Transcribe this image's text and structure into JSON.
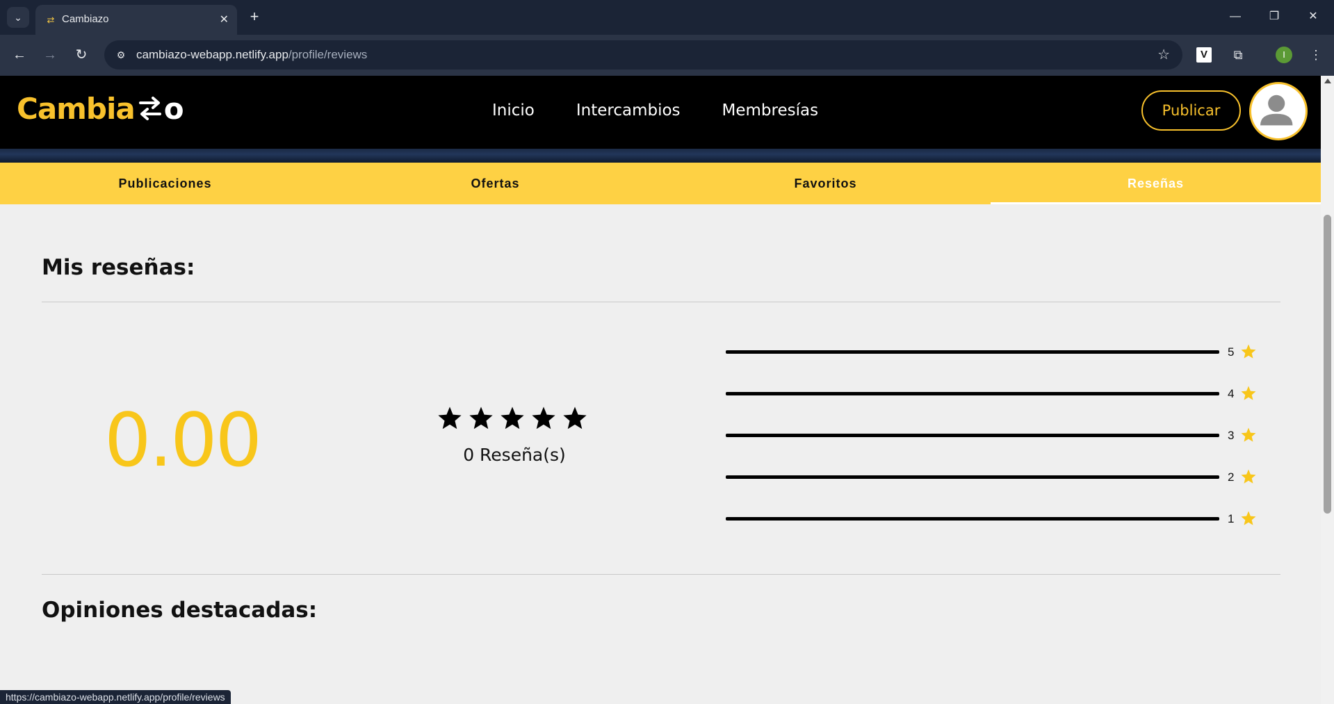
{
  "browser": {
    "tab_title": "Cambiazo",
    "url_host": "cambiazo-webapp.netlify.app",
    "url_path": "/profile/reviews",
    "profile_initial": "I",
    "status_url": "https://cambiazo-webapp.netlify.app/profile/reviews"
  },
  "header": {
    "logo_text": "Cambia",
    "logo_suffix": "o",
    "nav": [
      "Inicio",
      "Intercambios",
      "Membresías"
    ],
    "publish_label": "Publicar"
  },
  "tabs": [
    {
      "label": "Publicaciones",
      "active": false
    },
    {
      "label": "Ofertas",
      "active": false
    },
    {
      "label": "Favoritos",
      "active": false
    },
    {
      "label": "Reseñas",
      "active": true
    }
  ],
  "reviews": {
    "title": "Mis reseñas:",
    "average": "0.00",
    "stars_filled": 0,
    "count_label": "0 Reseña(s)",
    "distribution": [
      {
        "stars": "5",
        "fraction": 0
      },
      {
        "stars": "4",
        "fraction": 0
      },
      {
        "stars": "3",
        "fraction": 0
      },
      {
        "stars": "2",
        "fraction": 0
      },
      {
        "stars": "1",
        "fraction": 0
      }
    ],
    "featured_title": "Opiniones destacadas:"
  },
  "colors": {
    "accent": "#f8c61a",
    "tab_bar": "#fed144",
    "header_bg": "#000000",
    "page_bg": "#efefef"
  }
}
